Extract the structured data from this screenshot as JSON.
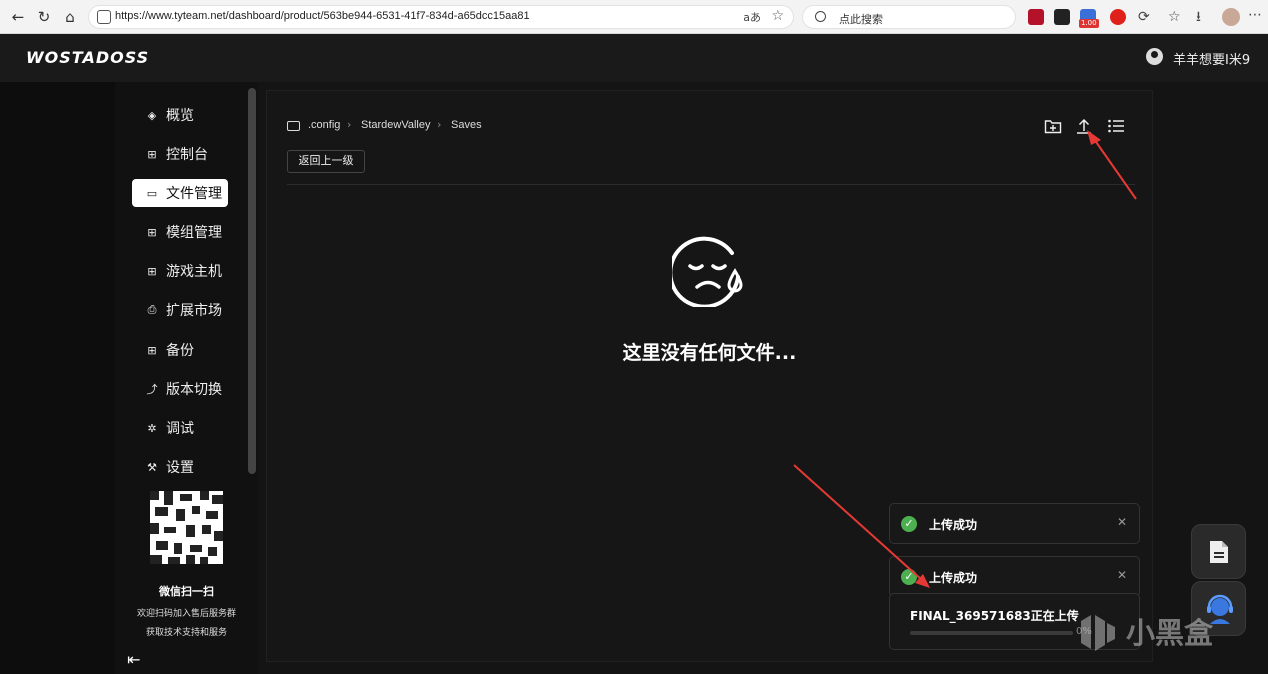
{
  "browser": {
    "url": "https://www.tyteam.net/dashboard/product/563be944-6531-41f7-834d-a65dcc15aa81",
    "reader_label": "aあ",
    "search_placeholder": "点此搜索",
    "extension_badge": "1.00"
  },
  "app": {
    "logo": "WOSTADOSS",
    "user_name": "羊羊想要I米9"
  },
  "sidebar": {
    "items": [
      {
        "label": "概览",
        "icon": "layers-icon",
        "glyph": "◈",
        "active": false
      },
      {
        "label": "控制台",
        "icon": "grid-icon",
        "glyph": "⊞",
        "active": false
      },
      {
        "label": "文件管理",
        "icon": "folder-icon",
        "glyph": "▭",
        "active": true
      },
      {
        "label": "模组管理",
        "icon": "modules-icon",
        "glyph": "⊞",
        "active": false
      },
      {
        "label": "游戏主机",
        "icon": "server-icon",
        "glyph": "⊞",
        "active": false
      },
      {
        "label": "扩展市场",
        "icon": "package-icon",
        "glyph": "⎙",
        "active": false
      },
      {
        "label": "备份",
        "icon": "backup-icon",
        "glyph": "⊞",
        "active": false
      },
      {
        "label": "版本切换",
        "icon": "switch-icon",
        "glyph": "⤴",
        "active": false
      },
      {
        "label": "调试",
        "icon": "bug-icon",
        "glyph": "✲",
        "active": false
      },
      {
        "label": "设置",
        "icon": "wrench-icon",
        "glyph": "⚒",
        "active": false
      }
    ],
    "qr_title": "微信扫一扫",
    "qr_line1": "欢迎扫码加入售后服务群",
    "qr_line2": "获取技术支持和服务"
  },
  "files": {
    "breadcrumb": [
      ".config",
      "StardewValley",
      "Saves"
    ],
    "back_label": "返回上一级",
    "empty_text": "这里没有任何文件..."
  },
  "toasts": [
    {
      "message": "上传成功"
    },
    {
      "message": "上传成功"
    }
  ],
  "upload": {
    "file_label": "FINAL_369571683正在上传",
    "progress": 0,
    "progress_text": "0%"
  },
  "watermark": "小黑盒",
  "colors": {
    "accent": "#1e40d8",
    "success": "#4caf50",
    "annotation": "#e53935"
  }
}
